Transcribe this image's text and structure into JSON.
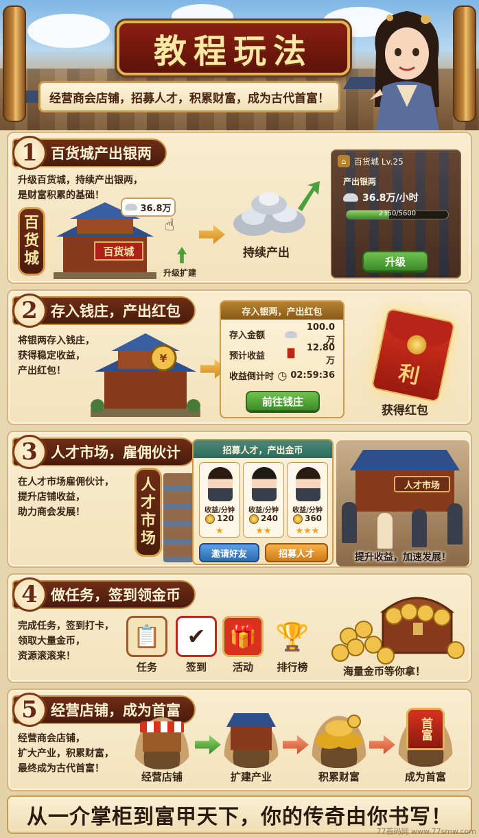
{
  "hero": {
    "title": "教程玩法",
    "subtitle": "经营商会店铺，招募人才，积累财富，成为古代首富！"
  },
  "s1": {
    "num": "1",
    "title": "百货城产出银两",
    "desc": [
      "升级百货城，持续产出银两，",
      "是财富积累的基础！"
    ],
    "vertical_sign": [
      "百",
      "货",
      "城"
    ],
    "building_sign": "百货城",
    "bubble_value": "36.8万",
    "upgrade_expand": "升级扩建",
    "continuous_output": "持续产出",
    "card": {
      "name": "百货城 Lv.25",
      "output_label": "产出银两",
      "rate": "36.8万/小时",
      "progress_text": "2350/5600",
      "progress": 0.42,
      "button": "升级"
    }
  },
  "s2": {
    "num": "2",
    "title": "存入钱庄，产出红包",
    "desc": [
      "将银两存入钱庄，",
      "获得稳定收益，",
      "产出红包！"
    ],
    "panel": {
      "title": "存入银两，产出红包",
      "rows": [
        {
          "key": "存入金额",
          "value": "100.0万"
        },
        {
          "key": "预计收益",
          "value": "12.80万"
        },
        {
          "key": "收益倒计时",
          "value": "02:59:36"
        }
      ],
      "button": "前往钱庄"
    },
    "envelope_char": "利",
    "caption": "获得红包"
  },
  "s3": {
    "num": "3",
    "title": "人才市场，雇佣伙计",
    "desc": [
      "在人才市场雇佣伙计，",
      "提升店铺收益，",
      "助力商会发展！"
    ],
    "vertical_sign": [
      "人",
      "才",
      "市",
      "场"
    ],
    "panel": {
      "title": "招募人才，产出金币",
      "cards": [
        {
          "label": "收益/分钟",
          "value": "120",
          "stars": "★"
        },
        {
          "label": "收益/分钟",
          "value": "240",
          "stars": "★★"
        },
        {
          "label": "收益/分钟",
          "value": "360",
          "stars": "★★★"
        }
      ],
      "invite_button": "邀请好友",
      "recruit_button": "招募人才"
    },
    "market_sign": "人才市场",
    "caption": "提升收益，加速发展！"
  },
  "s4": {
    "num": "4",
    "title": "做任务，签到领金币",
    "desc": [
      "完成任务，签到打卡，",
      "领取大量金币，",
      "资源滚滚来！"
    ],
    "icons": [
      {
        "label": "任务"
      },
      {
        "label": "签到"
      },
      {
        "label": "活动"
      },
      {
        "label": "排行榜"
      }
    ],
    "caption": "海量金币等你拿！"
  },
  "s5": {
    "num": "5",
    "title": "经营店铺，成为首富",
    "desc": [
      "经营商会店铺，",
      "扩大产业，积累财富，",
      "最终成为古代首富！"
    ],
    "stages": [
      {
        "label": "经营店铺"
      },
      {
        "label": "扩建产业"
      },
      {
        "label": "积累财富"
      },
      {
        "label": "成为首富"
      }
    ],
    "richest_sign": "首富"
  },
  "footer": {
    "slogan": "从一介掌柜到富甲天下，你的传奇由你书写！"
  },
  "watermark": "77首码网 www.77smw.com"
}
